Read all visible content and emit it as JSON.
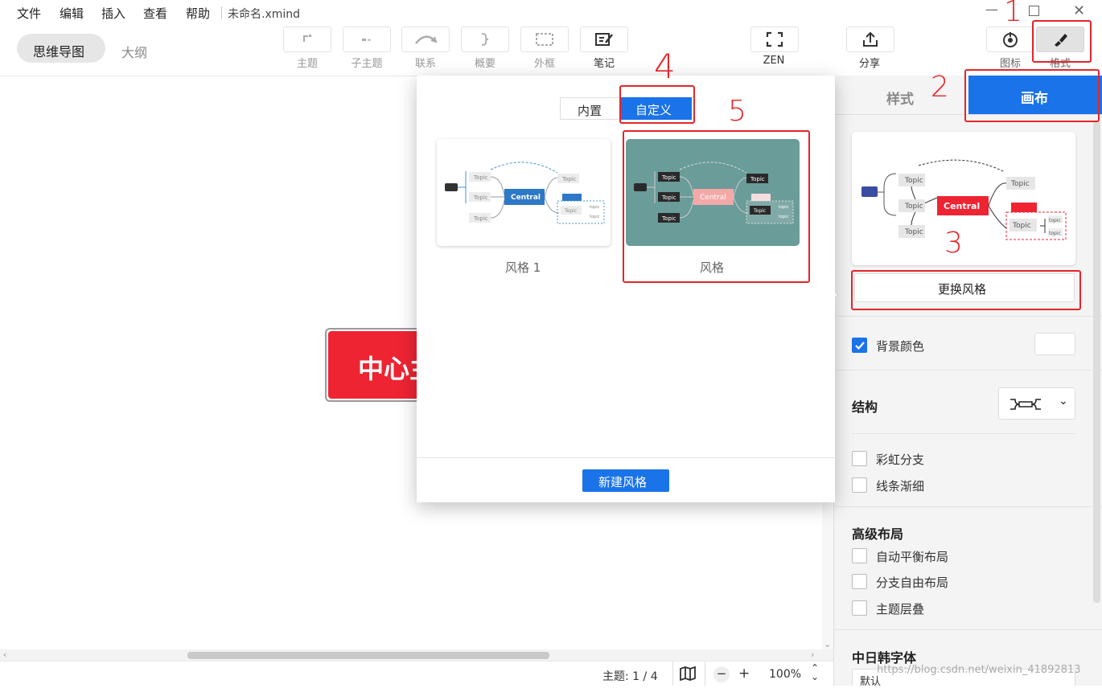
{
  "menu": {
    "file": "文件",
    "edit": "编辑",
    "insert": "插入",
    "view": "查看",
    "help": "帮助",
    "filename": "未命名.xmind"
  },
  "view_tabs": {
    "mindmap": "思维导图",
    "outline": "大纲"
  },
  "toolbar": {
    "topic": "主题",
    "subtopic": "子主题",
    "relation": "联系",
    "summary": "概要",
    "boundary": "外框",
    "note": "笔记",
    "zen": "ZEN",
    "share": "分享",
    "icon": "图标",
    "format": "格式"
  },
  "canvas": {
    "central_text": "中心主题"
  },
  "status": {
    "topics": "主题: 1 / 4",
    "zoom": "100%"
  },
  "popup": {
    "tab_builtin": "内置",
    "tab_custom": "自定义",
    "style1_name": "风格 1",
    "style2_name": "风格",
    "new_style": "新建风格"
  },
  "thumb": {
    "topic": "Topic",
    "central": "Central",
    "subtopic": "topic"
  },
  "panel": {
    "tab_style": "样式",
    "tab_canvas": "画布",
    "change_style": "更换风格",
    "bg_color": "背景颜色",
    "structure": "结构",
    "rainbow": "彩虹分支",
    "taper": "线条渐细",
    "advanced": "高级布局",
    "auto_balance": "自动平衡布局",
    "free_branch": "分支自由布局",
    "overlap": "主题层叠",
    "cjk_font": "中日韩字体",
    "font_default": "默认"
  },
  "annotations": {
    "a1": "1",
    "a2": "2",
    "a3": "3",
    "a4": "4",
    "a5": "5"
  },
  "watermark": "https://blog.csdn.net/weixin_41892813",
  "colors": {
    "accent": "#1a73e8",
    "central_red": "#ee2433",
    "teal": "#6a9c99",
    "red_annotation": "#e5252a"
  }
}
